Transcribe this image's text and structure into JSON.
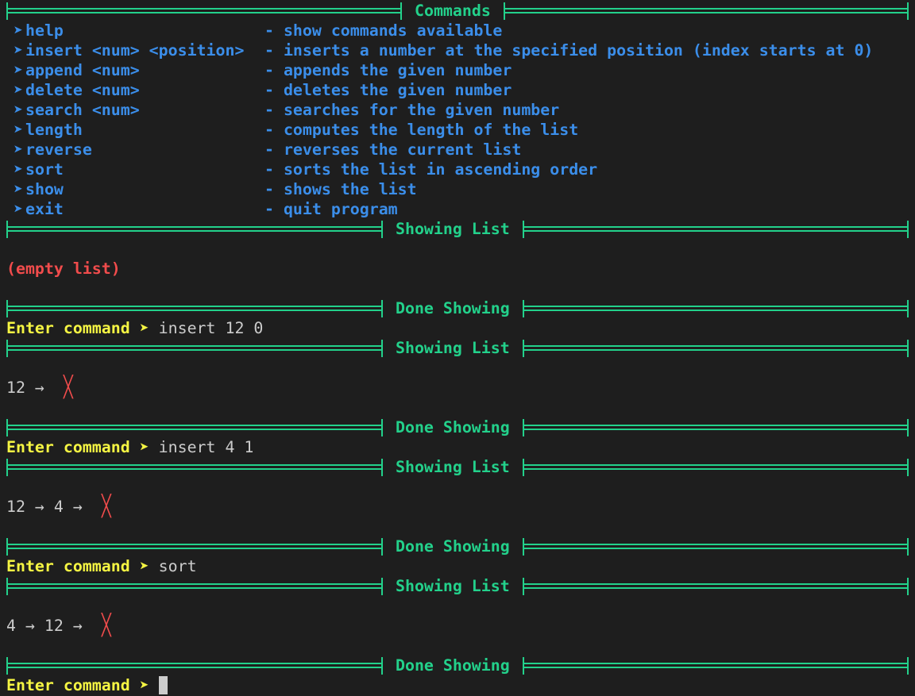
{
  "help": {
    "title": "Commands",
    "arrow": "➤",
    "commands": [
      {
        "name": "help",
        "desc": "- show commands available"
      },
      {
        "name": "insert <num> <position>",
        "desc": "- inserts a number at the specified position (index starts at 0)"
      },
      {
        "name": "append <num>",
        "desc": "- appends the given number"
      },
      {
        "name": "delete <num>",
        "desc": "- deletes the given number"
      },
      {
        "name": "search <num>",
        "desc": "- searches for the given number"
      },
      {
        "name": "length",
        "desc": "- computes the length of the list"
      },
      {
        "name": "reverse",
        "desc": "- reverses the current list"
      },
      {
        "name": "sort",
        "desc": "- sorts the list in ascending order"
      },
      {
        "name": "show",
        "desc": "- shows the list"
      },
      {
        "name": "exit",
        "desc": "- quit program"
      }
    ]
  },
  "labels": {
    "showing": "Showing List",
    "done": "Done Showing",
    "prompt": "Enter command",
    "prompt_arrow": "➤",
    "empty": "(empty list)",
    "null_mark": "╳"
  },
  "session": [
    {
      "command": "insert 12 0",
      "list": "12 → "
    },
    {
      "command": "insert 4 1",
      "list": "12 → 4 → "
    },
    {
      "command": "sort",
      "list": "4 → 12 → "
    }
  ],
  "colors": {
    "background": "#1e1e1e",
    "separator": "#23d18b",
    "help_text": "#3b8eea",
    "prompt": "#f5f543",
    "error": "#f14c4c",
    "foreground": "#cccccc"
  }
}
